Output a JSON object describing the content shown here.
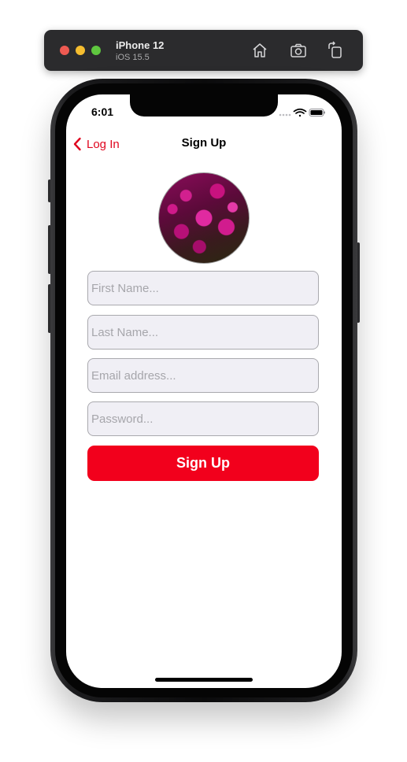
{
  "simulator": {
    "device_name": "iPhone 12",
    "os_version": "iOS 15.5",
    "icons": [
      "home-icon",
      "screenshot-icon",
      "rotate-icon"
    ]
  },
  "status_bar": {
    "time": "6:01",
    "icons": [
      "signal-icon",
      "wifi-icon",
      "battery-icon"
    ]
  },
  "nav_bar": {
    "back_label": "Log In",
    "title": "Sign Up"
  },
  "profile_image": {
    "icon": "flower-photo"
  },
  "form": {
    "first_name_placeholder": "First Name...",
    "last_name_placeholder": "Last Name...",
    "email_placeholder": "Email address...",
    "password_placeholder": "Password...",
    "first_name_value": "",
    "last_name_value": "",
    "email_value": "",
    "password_value": ""
  },
  "submit": {
    "label": "Sign Up"
  },
  "colors": {
    "accent": "#e0061f",
    "button": "#f2001c",
    "field_background": "#f0eff5"
  }
}
